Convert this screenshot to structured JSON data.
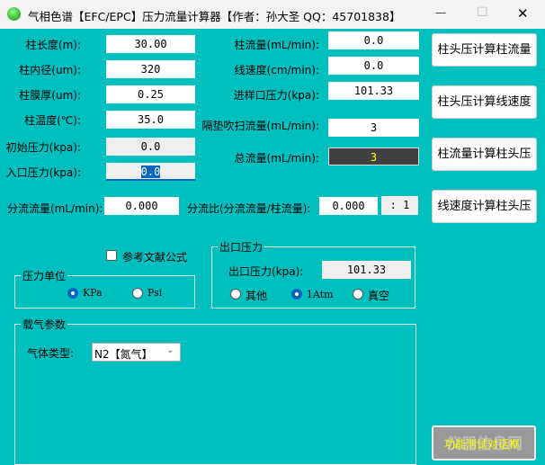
{
  "window": {
    "title": "气相色谱【EFC/EPC】压力流量计算器【作者：孙大圣 QQ：45701838】",
    "minimize": "—",
    "maximize": "☐",
    "close": "✕"
  },
  "left": [
    {
      "label": "柱长度(m):",
      "value": "30.00"
    },
    {
      "label": "柱内径(um):",
      "value": "320"
    },
    {
      "label": "柱膜厚(um):",
      "value": "0.25"
    },
    {
      "label": "柱温度(℃):",
      "value": "35.0"
    },
    {
      "label": "初始压力(kpa):",
      "value": "0.0"
    },
    {
      "label": "入口压力(kpa):",
      "value": "0.0"
    }
  ],
  "middle": [
    {
      "label": "柱流量(mL/min):",
      "value": "0.0"
    },
    {
      "label": "线速度(cm/min):",
      "value": "0.0"
    },
    {
      "label": "进样口压力(kpa):",
      "value": "101.33"
    },
    {
      "label": "隔垫吹扫流量(mL/min):",
      "value": "3"
    },
    {
      "label": "总流量(mL/min):",
      "value": "3"
    }
  ],
  "buttons": [
    "柱头压计算柱流量",
    "柱头压计算线速度",
    "柱流量计算柱头压",
    "线速度计算柱头压"
  ],
  "split": {
    "flow_label": "分流流量(mL/min):",
    "flow_value": "0.000",
    "ratio_label": "分流比(分流流量/柱流量):",
    "ratio_value": "0.000",
    "ratio_suffix": ": 1"
  },
  "reference_formula": {
    "label": "参考文献公式",
    "checked": false
  },
  "pressure_unit": {
    "title": "压力单位",
    "options": [
      "KPa",
      "Psi"
    ],
    "selected": "KPa"
  },
  "outlet": {
    "title": "出口压力",
    "label": "出口压力(kpa):",
    "value": "101.33",
    "options": [
      "其他",
      "1Atm",
      "真空"
    ],
    "selected": "1Atm"
  },
  "carrier": {
    "title": "载气参数",
    "gas_label": "气体类型:",
    "gas_value": "N2【氮气】"
  },
  "test_button": "功能测试对话框",
  "watermark": "仪器信息网",
  "colors": {
    "background": "#00bfbf",
    "total_flow_bg": "#404040",
    "total_flow_text": "#ffff00",
    "accent": "#0a64c0"
  }
}
